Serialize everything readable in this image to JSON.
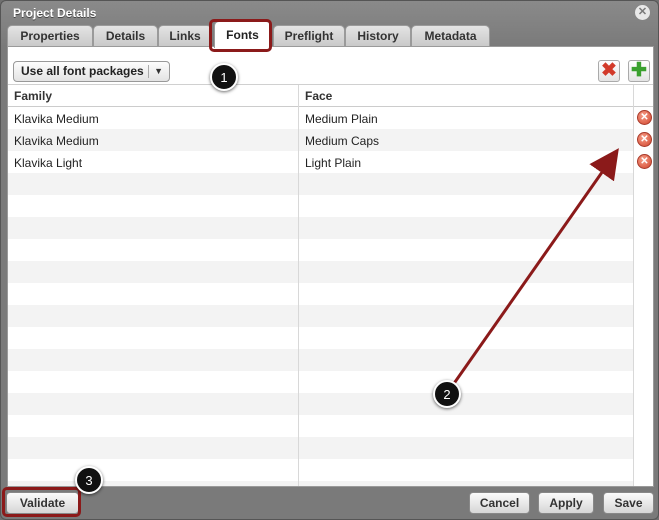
{
  "window": {
    "title": "Project Details"
  },
  "tabs": [
    {
      "label": "Properties",
      "active": false
    },
    {
      "label": "Details",
      "active": false
    },
    {
      "label": "Links",
      "active": false
    },
    {
      "label": "Fonts",
      "active": true
    },
    {
      "label": "Preflight",
      "active": false
    },
    {
      "label": "History",
      "active": false
    },
    {
      "label": "Metadata",
      "active": false
    }
  ],
  "toolbar": {
    "package_select": "Use all font packages"
  },
  "table": {
    "columns": [
      "Family",
      "Face"
    ],
    "rows": [
      {
        "family": "Klavika Medium",
        "face": "Medium Plain"
      },
      {
        "family": "Klavika Medium",
        "face": "Medium Caps"
      },
      {
        "family": "Klavika Light",
        "face": "Light Plain"
      }
    ]
  },
  "buttons": {
    "validate": "Validate",
    "cancel": "Cancel",
    "apply": "Apply",
    "save": "Save"
  },
  "annotations": [
    "1",
    "2",
    "3"
  ],
  "colors": {
    "highlight": "#8b1a1a",
    "delete": "#d2442c",
    "add": "#3aa02e"
  }
}
